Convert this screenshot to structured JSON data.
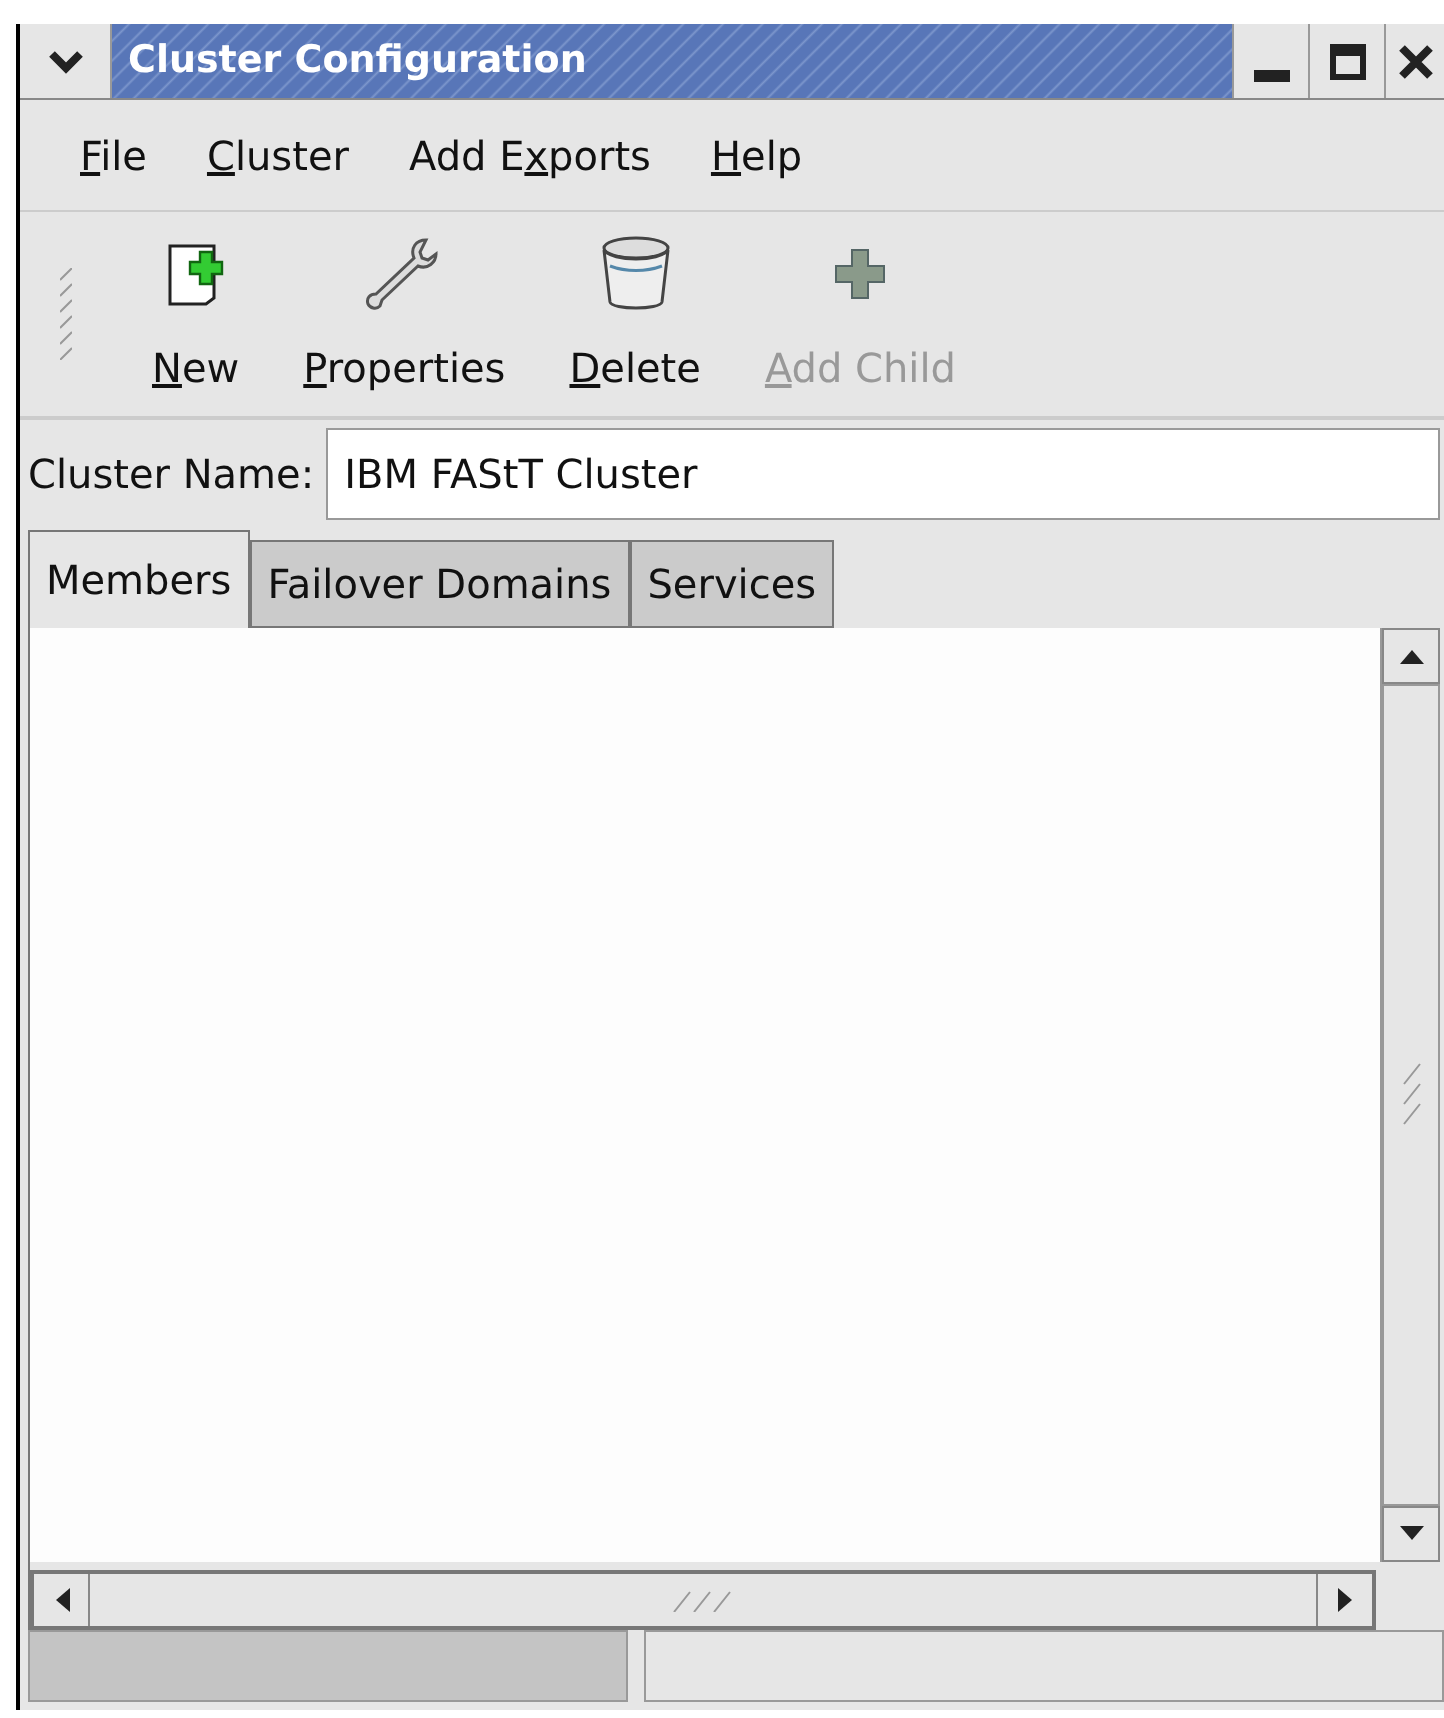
{
  "window": {
    "title": "Cluster Configuration"
  },
  "menu": [
    {
      "key": "F",
      "after": "ile"
    },
    {
      "key": "C",
      "after": "luster"
    },
    {
      "before": "Add E",
      "key": "x",
      "after": "ports"
    },
    {
      "key": "H",
      "after": "elp"
    }
  ],
  "toolbar": [
    {
      "kind": "new",
      "key": "N",
      "after": "ew",
      "disabled": false
    },
    {
      "kind": "properties",
      "key": "P",
      "after": "roperties",
      "disabled": false
    },
    {
      "kind": "delete",
      "key": "D",
      "after": "elete",
      "disabled": false
    },
    {
      "kind": "add-child",
      "key": "A",
      "after": "dd Child",
      "disabled": true
    }
  ],
  "cluster_name": {
    "label": "Cluster Name:",
    "value": "IBM FAStT Cluster"
  },
  "tabs": [
    {
      "label": "Members",
      "selected": true
    },
    {
      "label": "Failover Domains",
      "selected": false
    },
    {
      "label": "Services",
      "selected": false
    }
  ]
}
